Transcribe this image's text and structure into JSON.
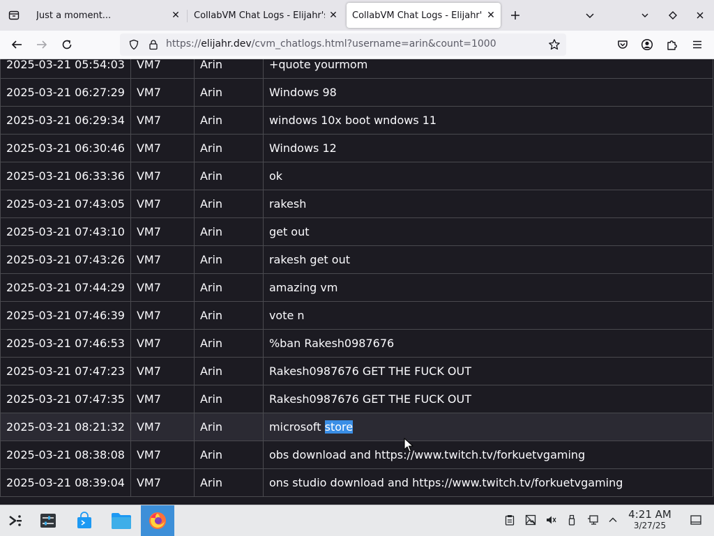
{
  "browser": {
    "tabs": [
      {
        "title": "Just a moment...",
        "active": false
      },
      {
        "title": "CollabVM Chat Logs - Elijahr's",
        "active": false
      },
      {
        "title": "CollabVM Chat Logs - Elijahr's",
        "active": true
      }
    ],
    "url_prefix": "https://",
    "url_host": "elijahr.dev",
    "url_path": "/cvm_chatlogs.html?username=arin&count=1000"
  },
  "log_rows": [
    {
      "time": "2025-03-21 05:54:03",
      "vm": "VM7",
      "user": "Arin",
      "message": "+quote yourmom"
    },
    {
      "time": "2025-03-21 06:27:29",
      "vm": "VM7",
      "user": "Arin",
      "message": "Windows 98"
    },
    {
      "time": "2025-03-21 06:29:34",
      "vm": "VM7",
      "user": "Arin",
      "message": "windows 10x boot wndows 11"
    },
    {
      "time": "2025-03-21 06:30:46",
      "vm": "VM7",
      "user": "Arin",
      "message": "Windows 12"
    },
    {
      "time": "2025-03-21 06:33:36",
      "vm": "VM7",
      "user": "Arin",
      "message": "ok"
    },
    {
      "time": "2025-03-21 07:43:05",
      "vm": "VM7",
      "user": "Arin",
      "message": "rakesh"
    },
    {
      "time": "2025-03-21 07:43:10",
      "vm": "VM7",
      "user": "Arin",
      "message": "get out"
    },
    {
      "time": "2025-03-21 07:43:26",
      "vm": "VM7",
      "user": "Arin",
      "message": "rakesh get out"
    },
    {
      "time": "2025-03-21 07:44:29",
      "vm": "VM7",
      "user": "Arin",
      "message": "amazing vm"
    },
    {
      "time": "2025-03-21 07:46:39",
      "vm": "VM7",
      "user": "Arin",
      "message": "vote n"
    },
    {
      "time": "2025-03-21 07:46:53",
      "vm": "VM7",
      "user": "Arin",
      "message": "%ban Rakesh0987676"
    },
    {
      "time": "2025-03-21 07:47:23",
      "vm": "VM7",
      "user": "Arin",
      "message": "Rakesh0987676 GET THE FUCK OUT"
    },
    {
      "time": "2025-03-21 07:47:35",
      "vm": "VM7",
      "user": "Arin",
      "message": "Rakesh0987676 GET THE FUCK OUT"
    },
    {
      "time": "2025-03-21 08:21:32",
      "vm": "VM7",
      "user": "Arin",
      "message": "microsoft ",
      "selected_text": "store",
      "hovered": true
    },
    {
      "time": "2025-03-21 08:38:08",
      "vm": "VM7",
      "user": "Arin",
      "message": "obs download and https://www.twitch.tv/forkuetvgaming"
    },
    {
      "time": "2025-03-21 08:39:04",
      "vm": "VM7",
      "user": "Arin",
      "message": "ons studio download and https://www.twitch.tv/forkuetvgaming"
    }
  ],
  "taskbar": {
    "time": "4:21 AM",
    "date": "3/27/25"
  },
  "colors": {
    "page_bg": "#1c1b22",
    "selection": "#3a8ee6",
    "taskbar_active": "#3d8fd8"
  }
}
